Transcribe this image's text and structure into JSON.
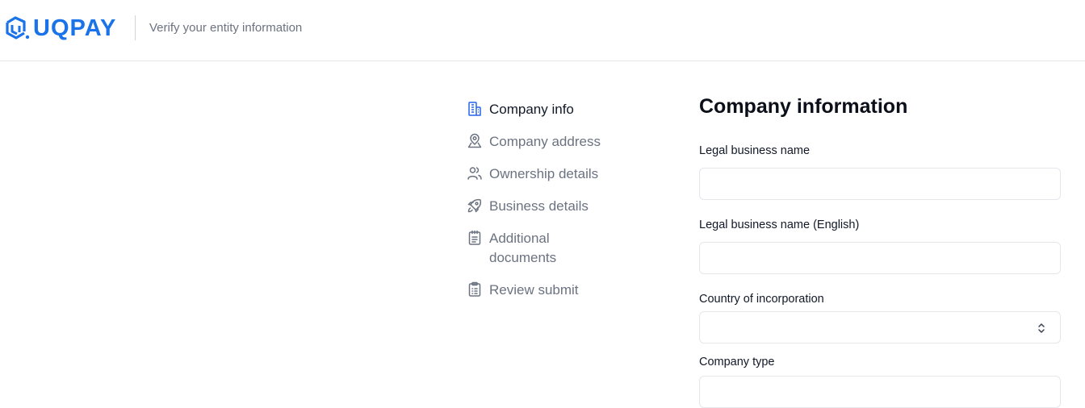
{
  "header": {
    "brand": "UQPAY",
    "subtitle": "Verify your entity information",
    "brand_color": "#1a73e8"
  },
  "steps": [
    {
      "label": "Company info",
      "icon": "building-icon",
      "active": true
    },
    {
      "label": "Company address",
      "icon": "map-pin-icon",
      "active": false
    },
    {
      "label": "Ownership details",
      "icon": "users-icon",
      "active": false
    },
    {
      "label": "Business details",
      "icon": "rocket-icon",
      "active": false
    },
    {
      "label": "Additional documents",
      "icon": "notepad-icon",
      "active": false
    },
    {
      "label": "Review submit",
      "icon": "clipboard-list-icon",
      "active": false
    }
  ],
  "form": {
    "title": "Company information",
    "fields": {
      "legal_name": {
        "label": "Legal business name",
        "value": "",
        "placeholder": ""
      },
      "legal_name_en": {
        "label": "Legal business name (English)",
        "value": "",
        "placeholder": ""
      },
      "country": {
        "label": "Country of incorporation",
        "value": ""
      },
      "company_type": {
        "label": "Company type",
        "value": ""
      }
    }
  },
  "colors": {
    "accent": "#1a73e8",
    "muted_text": "#6b7280",
    "border": "#e5e7eb"
  }
}
